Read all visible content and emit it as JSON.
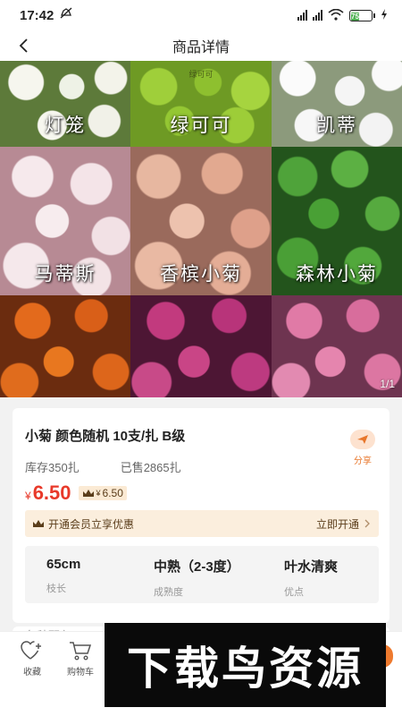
{
  "status_bar": {
    "time": "17:42",
    "battery": "75"
  },
  "header": {
    "title": "商品详情"
  },
  "gallery": {
    "tiles": [
      {
        "label": "灯笼"
      },
      {
        "label": "绿可可",
        "tag": "绿可可"
      },
      {
        "label": "凯蒂"
      },
      {
        "label": "马蒂斯"
      },
      {
        "label": "香槟小菊"
      },
      {
        "label": "森林小菊"
      },
      {
        "label": ""
      },
      {
        "label": ""
      },
      {
        "label": ""
      }
    ],
    "page_indicator": "1/1"
  },
  "product": {
    "title": "小菊 颜色随机 10支/扎 B级",
    "share_label": "分享",
    "stock": "库存350扎",
    "sold": "已售2865扎",
    "price_symbol": "¥",
    "price": "6.50",
    "vip_symbol": "¥",
    "vip_price": "6.50"
  },
  "member_banner": {
    "text": "开通会员立享优惠",
    "action": "立即开通"
  },
  "attributes": [
    {
      "value": "65cm",
      "label": "枝长"
    },
    {
      "value": "中熟（2-3度）",
      "label": "成熟度"
    },
    {
      "value": "叶水清爽",
      "label": "优点"
    }
  ],
  "section2": {
    "title": "各种配色"
  },
  "bottom_bar": {
    "favorite_label": "收藏",
    "cart_label": "购物车"
  },
  "watermark": {
    "text": "下载鸟资源"
  },
  "colors": {
    "price": "#e8392a",
    "accent": "#e8762a",
    "member_bg": "#fbeedd"
  }
}
